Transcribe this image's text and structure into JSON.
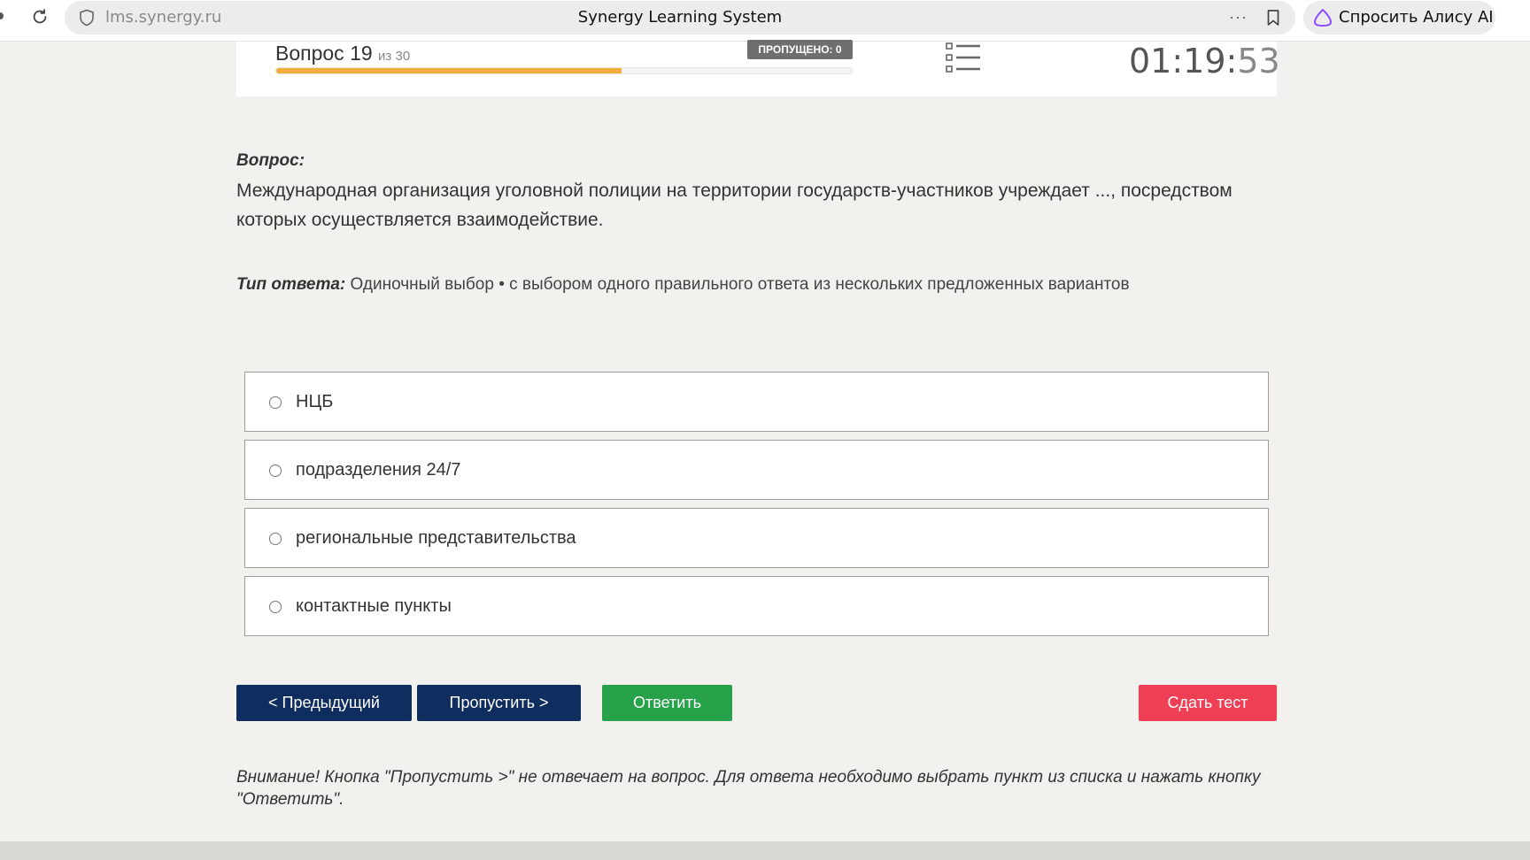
{
  "browser": {
    "url": "lms.synergy.ru",
    "tab_title": "Synergy Learning System",
    "more": "···",
    "alice_label": "Спросить Алису AI"
  },
  "header": {
    "question_label": "Вопрос",
    "question_number": "19",
    "question_of": "из 30",
    "progress_fraction": 0.6,
    "skipped_badge": "ПРОПУЩЕНО: 0",
    "timer_main": "01:19:",
    "timer_seconds": "53"
  },
  "question": {
    "heading": "Вопрос:",
    "text": "Международная организация уголовной полиции на территории государств-участников учреждает ..., посредством которых осуществляется взаимодействие.",
    "answer_type_label": "Тип ответа:",
    "answer_type_value": " Одиночный выбор • с выбором одного правильного ответа из нескольких предложенных вариантов"
  },
  "options": [
    {
      "label": "НЦБ"
    },
    {
      "label": "подразделения 24/7"
    },
    {
      "label": "региональные представительства"
    },
    {
      "label": "контактные пункты"
    }
  ],
  "buttons": {
    "prev": "< Предыдущий",
    "skip": "Пропустить >",
    "answer": "Ответить",
    "submit": "Сдать тест"
  },
  "notice": "Внимание! Кнопка \"Пропустить >\" не отвечает на вопрос. Для ответа необходимо выбрать пункт из списка и нажать кнопку \"Ответить\".",
  "colors": {
    "progress": "#f2ae3d",
    "nav_button": "#0f2d5e",
    "answer_button": "#27a24a",
    "submit_button": "#ef3f55"
  }
}
